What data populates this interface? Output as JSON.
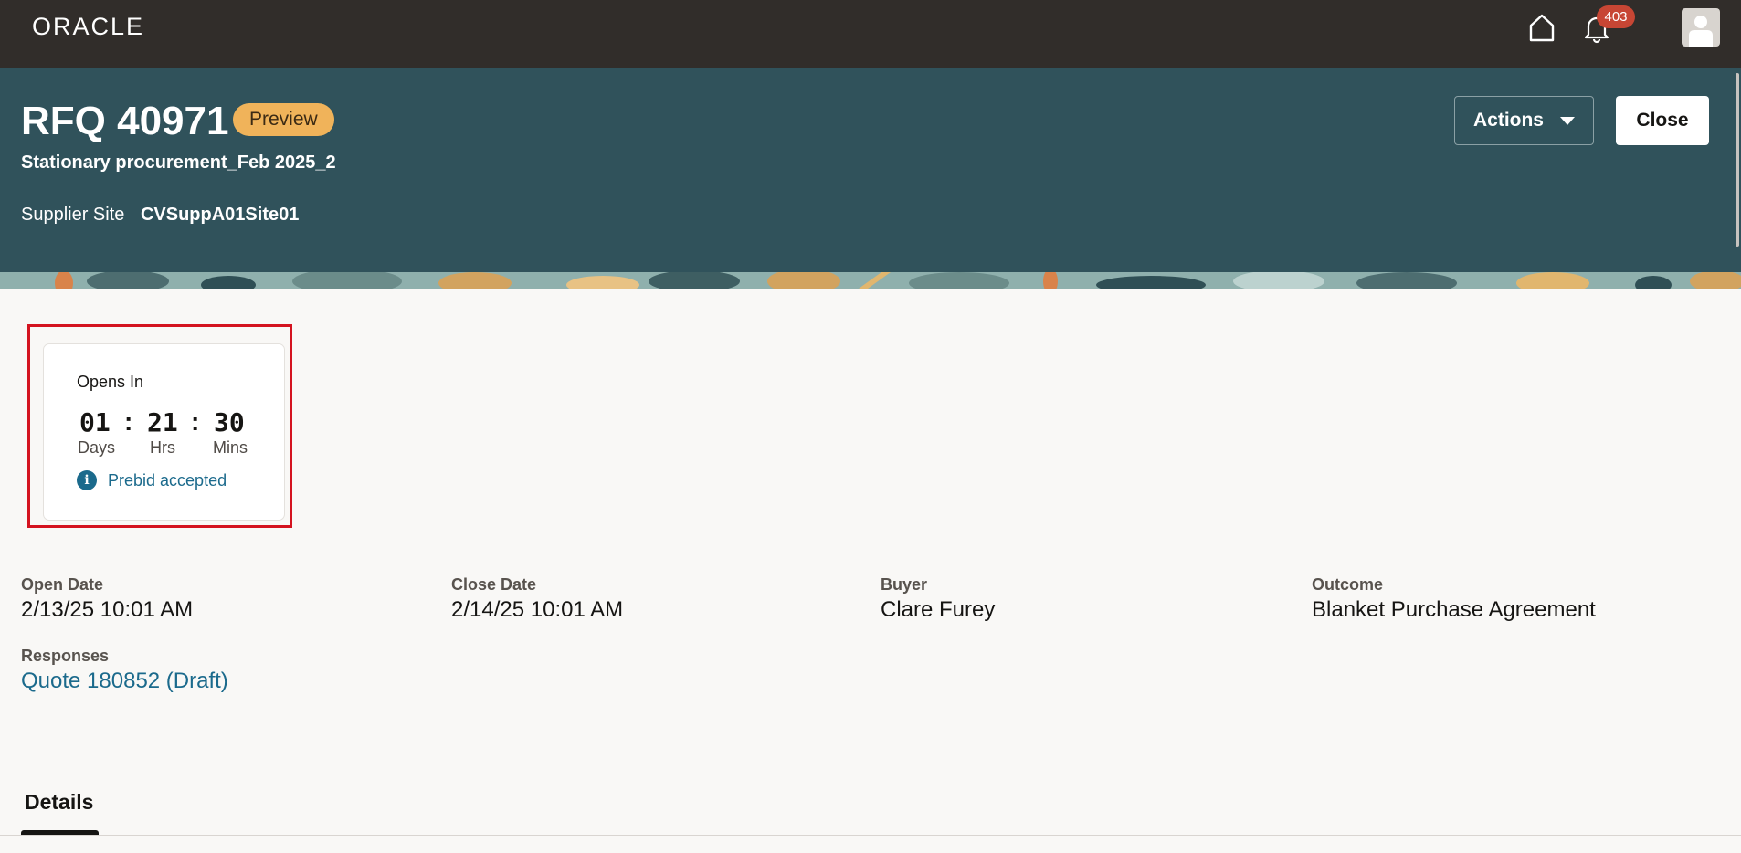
{
  "app": {
    "brand": "ORACLE"
  },
  "topbar": {
    "notification_count": "403"
  },
  "header": {
    "rfq_title": "RFQ 40971",
    "status_pill": "Preview",
    "subtitle": "Stationary procurement_Feb 2025_2",
    "supplier_site_label": "Supplier Site",
    "supplier_site_value": "CVSuppA01Site01",
    "actions_label": "Actions",
    "close_label": "Close"
  },
  "countdown": {
    "title": "Opens In",
    "days": "01",
    "hours": "21",
    "mins": "30",
    "separator": ":",
    "days_label": "Days",
    "hours_label": "Hrs",
    "mins_label": "Mins",
    "note": "Prebid accepted"
  },
  "summary": {
    "open_date_label": "Open Date",
    "open_date_value": "2/13/25 10:01 AM",
    "close_date_label": "Close Date",
    "close_date_value": "2/14/25 10:01 AM",
    "buyer_label": "Buyer",
    "buyer_value": "Clare Furey",
    "outcome_label": "Outcome",
    "outcome_value": "Blanket Purchase Agreement",
    "responses_label": "Responses",
    "responses_link": "Quote 180852 (Draft)"
  },
  "tabs": {
    "details": "Details"
  },
  "colors": {
    "topbar": "#312d2a",
    "header": "#30525b",
    "pill": "#f0b35a",
    "badge": "#c74634",
    "link": "#1b6a8c",
    "highlight": "#d4131f"
  }
}
